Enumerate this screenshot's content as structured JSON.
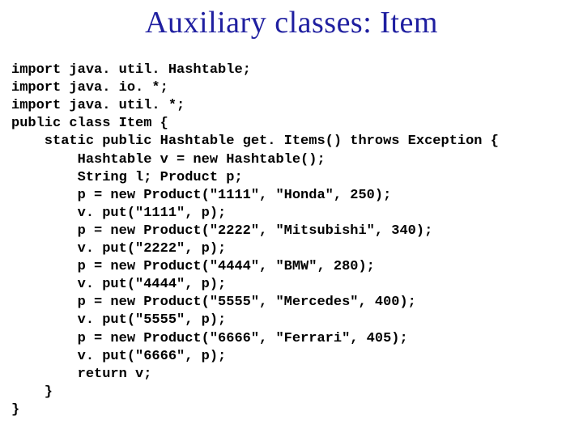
{
  "title": "Auxiliary classes: Item",
  "code": {
    "l01": "import java. util. Hashtable;",
    "l02": "import java. io. *;",
    "l03": "import java. util. *;",
    "l04": "public class Item {",
    "l05": "    static public Hashtable get. Items() throws Exception {",
    "l06": "        Hashtable v = new Hashtable();",
    "l07": "        String l; Product p;",
    "l08": "        p = new Product(\"1111\", \"Honda\", 250);",
    "l09": "        v. put(\"1111\", p);",
    "l10": "        p = new Product(\"2222\", \"Mitsubishi\", 340);",
    "l11": "        v. put(\"2222\", p);",
    "l12": "        p = new Product(\"4444\", \"BMW\", 280);",
    "l13": "        v. put(\"4444\", p);",
    "l14": "        p = new Product(\"5555\", \"Mercedes\", 400);",
    "l15": "        v. put(\"5555\", p);",
    "l16": "        p = new Product(\"6666\", \"Ferrari\", 405);",
    "l17": "        v. put(\"6666\", p);",
    "l18": "        return v;",
    "l19": "    }",
    "l20": "}"
  }
}
